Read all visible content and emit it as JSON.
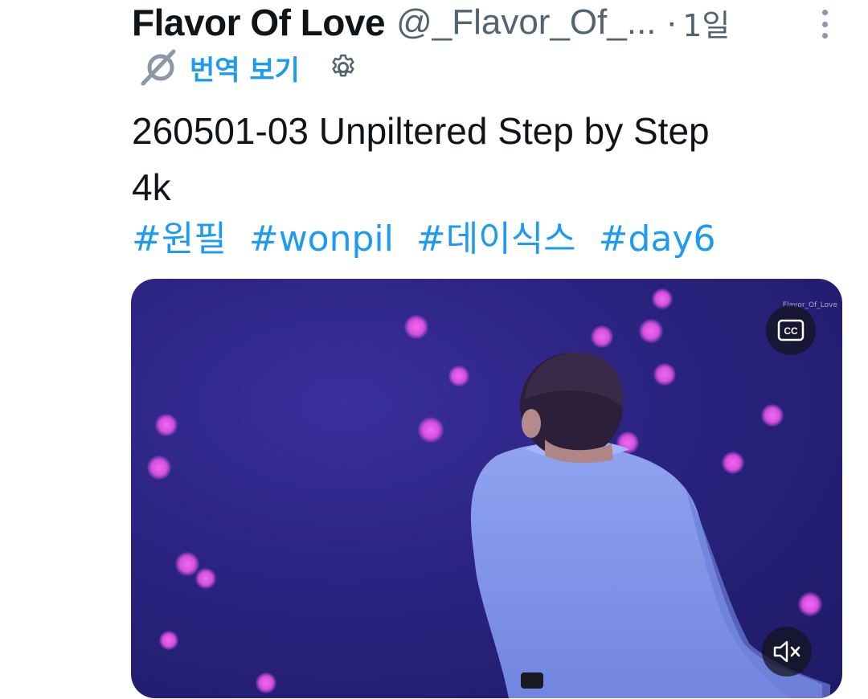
{
  "tweet": {
    "display_name": "Flavor Of Love",
    "handle": "@_Flavor_Of_...",
    "separator": "·",
    "time": "1일",
    "translate_label": "번역 보기",
    "text_lines": [
      "260501-03 Unpiltered Step by Step",
      "4k"
    ],
    "hashtags": [
      "#원필",
      "#wonpil",
      "#데이식스",
      "#day6"
    ]
  },
  "media": {
    "watermark": "Flavor_Of_Love",
    "cc_label": "CC",
    "cc_icon": "closed-captions-icon",
    "mute_icon": "volume-muted-icon"
  },
  "colors": {
    "link": "#1d9bf0",
    "text": "#0f1419",
    "secondary": "#536471"
  }
}
